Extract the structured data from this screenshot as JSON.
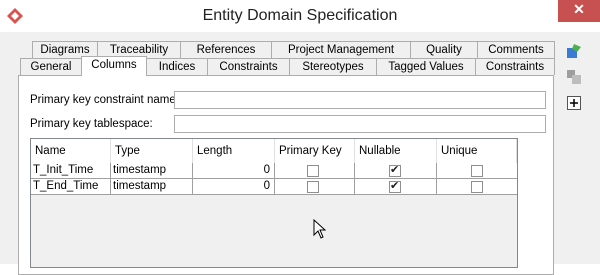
{
  "window": {
    "title": "Entity Domain Specification",
    "close_glyph": "✕"
  },
  "tabs": {
    "row1": [
      {
        "label": "Diagrams",
        "icon": ""
      },
      {
        "label": "Traceability"
      },
      {
        "label": "References"
      },
      {
        "label": "Project Management"
      },
      {
        "label": "Quality"
      },
      {
        "label": "Comments"
      }
    ],
    "row2": [
      {
        "label": "General"
      },
      {
        "label": "Columns",
        "active": true
      },
      {
        "label": "Indices"
      },
      {
        "label": "Constraints"
      },
      {
        "label": "Stereotypes"
      },
      {
        "label": "Tagged Values"
      },
      {
        "label": "Constraints"
      }
    ]
  },
  "form": {
    "pk_constraint_label": "Primary key constraint name:",
    "pk_constraint_value": "",
    "pk_tablespace_label": "Primary key tablespace:",
    "pk_tablespace_value": ""
  },
  "columns_table": {
    "headers": [
      "Name",
      "Type",
      "Length",
      "Primary Key",
      "Nullable",
      "Unique"
    ],
    "rows": [
      {
        "name": "T_Init_Time",
        "type": "timestamp",
        "length": "0",
        "primary_key": false,
        "nullable": true,
        "unique": false
      },
      {
        "name": "T_End_Time",
        "type": "timestamp",
        "length": "0",
        "primary_key": false,
        "nullable": true,
        "unique": false
      }
    ]
  },
  "side_icons": [
    "add-stereotype-icon",
    "constraint-icon",
    "add-icon"
  ],
  "colors": {
    "close_button": "#c75050",
    "app_icon": "#d9534f",
    "frame": "#f0f0f0"
  }
}
